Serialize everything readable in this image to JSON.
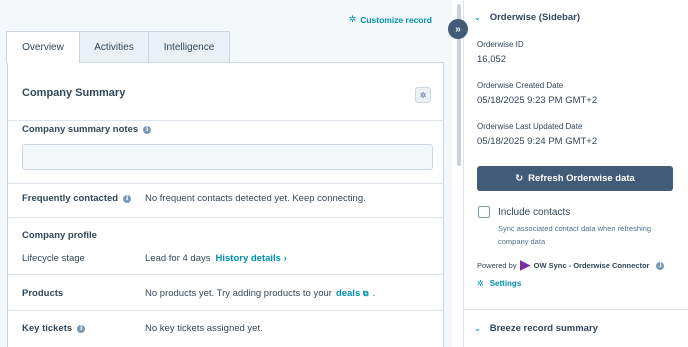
{
  "header": {
    "customize_label": "Customize record"
  },
  "tabs": [
    {
      "label": "Overview"
    },
    {
      "label": "Activities"
    },
    {
      "label": "Intelligence"
    }
  ],
  "summary": {
    "title": "Company Summary",
    "notes_label": "Company summary notes",
    "notes_value": "",
    "frequently_contacted_label": "Frequently contacted",
    "frequently_contacted_value": "No frequent contacts detected yet. Keep connecting.",
    "company_profile_label": "Company profile",
    "lifecycle_label": "Lifecycle stage",
    "lifecycle_value": "Lead for 4 days",
    "history_link": "History details",
    "products_label": "Products",
    "products_value_prefix": "No products yet. Try adding products to your",
    "products_link": "deals",
    "products_value_suffix": ".",
    "key_tickets_label": "Key tickets",
    "key_tickets_value": "No key tickets assigned yet."
  },
  "sidebar": {
    "section_title": "Orderwise (Sidebar)",
    "props": [
      {
        "label": "Orderwise ID",
        "value": "16,052"
      },
      {
        "label": "Orderwise Created Date",
        "value": "05/18/2025 9:23 PM GMT+2"
      },
      {
        "label": "Orderwise Last Updated Date",
        "value": "05/18/2025 9:24 PM GMT+2"
      }
    ],
    "refresh_label": "Refresh Orderwise data",
    "include_contacts_label": "Include contacts",
    "include_contacts_checked": false,
    "include_contacts_help": "Sync associated contact data when refreshing company data",
    "powered_by": "Powered by",
    "app_name": "OW Sync - Orderwise Connector",
    "settings_label": "Settings",
    "breeze_title": "Breeze record summary"
  },
  "colors": {
    "accent": "#0091ae",
    "button": "#425b76",
    "text": "#33475b",
    "app_logo": "#7a2ea0"
  },
  "icons": [
    "gear-icon",
    "info-icon",
    "chevron-down-icon",
    "refresh-icon",
    "double-chevron-right-icon",
    "external-link-icon",
    "chevron-right-icon"
  ]
}
